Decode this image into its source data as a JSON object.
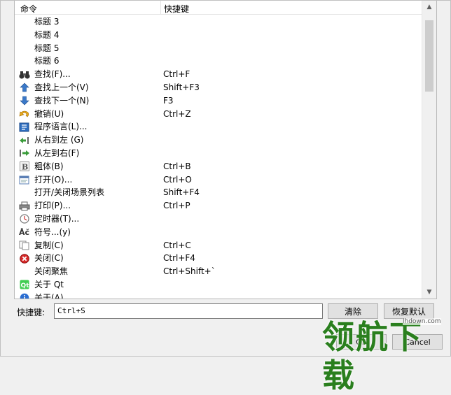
{
  "header": {
    "command_col": "命令",
    "shortcut_col": "快捷键"
  },
  "rows": [
    {
      "icon": "none",
      "cmd": "标题 3",
      "key": "",
      "indent": true
    },
    {
      "icon": "none",
      "cmd": "标题 4",
      "key": "",
      "indent": true
    },
    {
      "icon": "none",
      "cmd": "标题 5",
      "key": "",
      "indent": true
    },
    {
      "icon": "none",
      "cmd": "标题 6",
      "key": "",
      "indent": true
    },
    {
      "icon": "binoculars-icon",
      "cmd": "查找(F)...",
      "key": "Ctrl+F"
    },
    {
      "icon": "arrow-up-icon",
      "cmd": "查找上一个(V)",
      "key": "Shift+F3"
    },
    {
      "icon": "arrow-down-icon",
      "cmd": "查找下一个(N)",
      "key": "F3"
    },
    {
      "icon": "undo-icon",
      "cmd": "撤销(U)",
      "key": "Ctrl+Z"
    },
    {
      "icon": "language-icon",
      "cmd": "程序语言(L)...",
      "key": ""
    },
    {
      "icon": "rtl-icon",
      "cmd": "从右到左 (G)",
      "key": ""
    },
    {
      "icon": "ltr-icon",
      "cmd": "从左到右(F)",
      "key": ""
    },
    {
      "icon": "bold-icon",
      "cmd": "粗体(B)",
      "key": "Ctrl+B"
    },
    {
      "icon": "open-icon",
      "cmd": "打开(O)...",
      "key": "Ctrl+O"
    },
    {
      "icon": "none",
      "cmd": "打开/关闭场景列表",
      "key": "Shift+F4"
    },
    {
      "icon": "print-icon",
      "cmd": "打印(P)...",
      "key": "Ctrl+P"
    },
    {
      "icon": "timer-icon",
      "cmd": "定时器(T)...",
      "key": ""
    },
    {
      "icon": "symbol-icon",
      "cmd": "符号...(y)",
      "key": ""
    },
    {
      "icon": "copy-icon",
      "cmd": "复制(C)",
      "key": "Ctrl+C"
    },
    {
      "icon": "close-icon",
      "cmd": "关闭(C)",
      "key": "Ctrl+F4"
    },
    {
      "icon": "none",
      "cmd": "关闭聚焦",
      "key": "Ctrl+Shift+`"
    },
    {
      "icon": "qt-icon",
      "cmd": "关于 Qt",
      "key": ""
    },
    {
      "icon": "info-icon",
      "cmd": "关于(A)",
      "key": ""
    }
  ],
  "shortcut": {
    "label": "快捷键:",
    "value": "Ctrl+S"
  },
  "buttons": {
    "clear": "清除",
    "reset": "恢复默认",
    "ok": "OK",
    "cancel": "Cancel"
  },
  "watermark": {
    "text": "领航下载",
    "url": "lhdown.com"
  }
}
